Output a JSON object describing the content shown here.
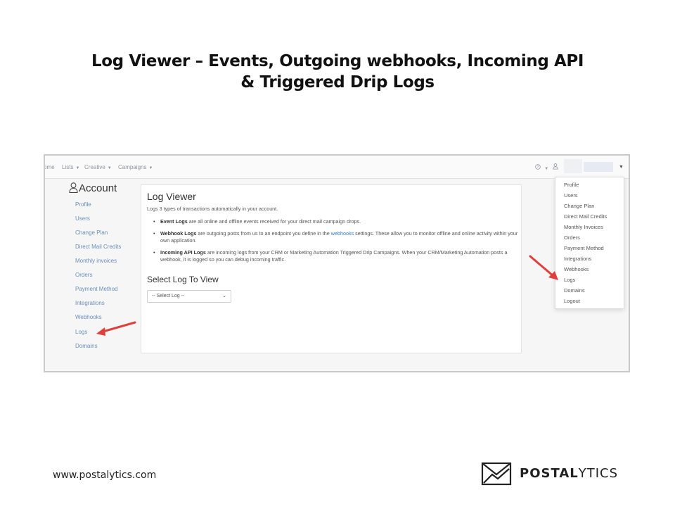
{
  "slide": {
    "title_line1": "Log Viewer – Events, Outgoing webhooks, Incoming API",
    "title_line2": "& Triggered Drip Logs"
  },
  "topnav": {
    "items": [
      "ome",
      "Lists",
      "Creative",
      "Campaigns"
    ],
    "help": "?"
  },
  "sidebar": {
    "title": "Account",
    "items": [
      "Profile",
      "Users",
      "Change Plan",
      "Direct Mail Credits",
      "Monthly invoices",
      "Orders",
      "Payment Method",
      "Integrations",
      "Webhooks",
      "Logs",
      "Domains"
    ]
  },
  "log_viewer": {
    "title": "Log Viewer",
    "subtitle": "Logs 3 types of transactions automatically in your account.",
    "bullet1_bold": "Event Logs",
    "bullet1_text": " are all online and offline events received for your direct mail campaign drops.",
    "bullet2_bold": "Webhook Logs",
    "bullet2_text_a": " are outgoing posts from us to an endpoint you define in the ",
    "bullet2_link": "webhooks",
    "bullet2_text_b": " settings. These allow you to monitor offline and online activity within your own application.",
    "bullet3_bold": "Incoming API Logs",
    "bullet3_text": " are incoming logs from your CRM or Marketing Automation Triggered Drip Campaigns. When your CRM/Marketing Automation posts a webhook, it is logged so you can debug incoming traffic.",
    "select_title": "Select Log To View",
    "select_value": "-- Select Log --"
  },
  "user_menu": {
    "items": [
      "Profile",
      "Users",
      "Change Plan",
      "Direct Mail Credits",
      "Monthly Invoices",
      "Orders",
      "Payment Method",
      "Integrations",
      "Webhooks",
      "Logs",
      "Domains",
      "Logout"
    ]
  },
  "footer": {
    "url": "www.postalytics.com",
    "logo_bold": "POSTAL",
    "logo_light": "YTICS"
  },
  "colors": {
    "link": "#6a8fb8",
    "arrow": "#e0403c"
  }
}
